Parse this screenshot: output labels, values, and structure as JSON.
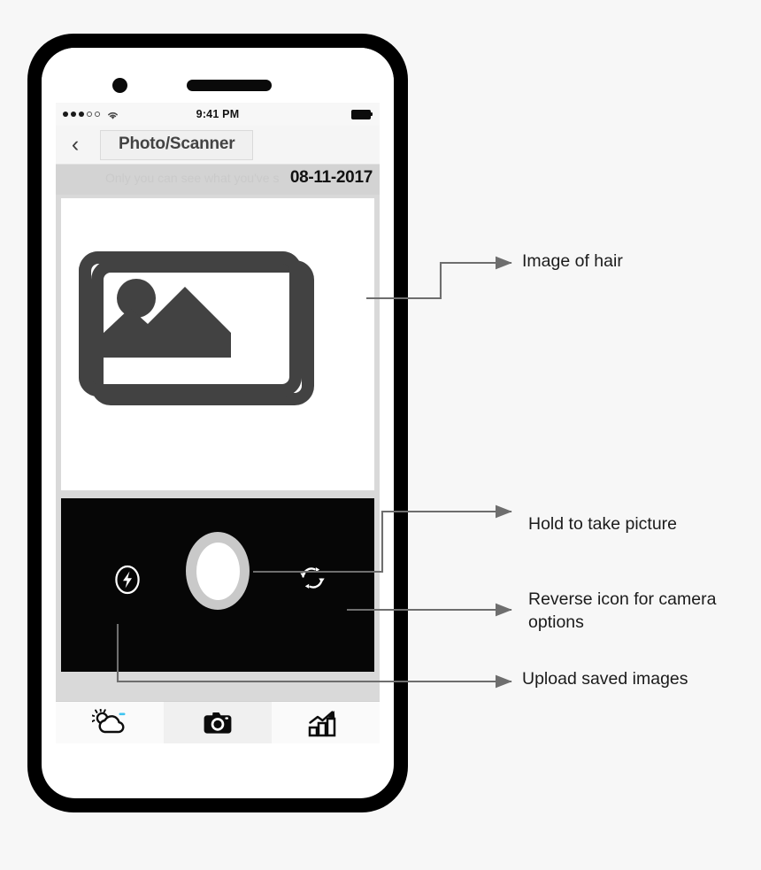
{
  "device": {
    "name": "smartphone-mockup",
    "front_camera": "camera-dot",
    "speaker": "earpiece-speaker"
  },
  "status_bar": {
    "signal_dots_filled": 3,
    "signal_dots_empty": 2,
    "wifi_icon": "wifi-icon",
    "time": "9:41 PM",
    "battery_icon": "battery-full-icon"
  },
  "nav_bar": {
    "back_icon": "chevron-left-icon",
    "back_glyph": "‹",
    "title": "Photo/Scanner"
  },
  "date_strip": {
    "ghost_note": "Only you can see what you've s",
    "date": "08-11-2017"
  },
  "preview": {
    "placeholder_icon": "stacked-photos-icon",
    "icon_color": "#424242"
  },
  "viewfinder": {
    "background": "#060606",
    "flash_icon": "flash-bolt-icon",
    "shutter_button": "shutter-button",
    "reverse_icon": "reverse-camera-icon"
  },
  "tab_bar": {
    "tabs": [
      {
        "name": "weather",
        "icon": "sun-cloud-icon",
        "accent": "#3fc4f0",
        "active": false
      },
      {
        "name": "camera",
        "icon": "camera-icon",
        "active": true
      },
      {
        "name": "stats",
        "icon": "bar-chart-arrow-icon",
        "active": false
      }
    ]
  },
  "annotations": [
    {
      "id": "hair",
      "text": "Image of hair"
    },
    {
      "id": "hold",
      "text": "Hold to take picture"
    },
    {
      "id": "reverse",
      "text": "Reverse icon for camera options"
    },
    {
      "id": "upload",
      "text": "Upload saved images"
    }
  ],
  "annotation_text": {
    "hair": "Image of hair",
    "hold": "Hold to take picture",
    "reverse": "Reverse icon for camera options",
    "upload": "Upload saved images"
  },
  "colors": {
    "phone_frame": "#000000",
    "screen_chrome": "#f5f5f5",
    "date_strip": "#d3d3d3",
    "viewfinder": "#060606",
    "leader_line": "#6e6e6e"
  }
}
